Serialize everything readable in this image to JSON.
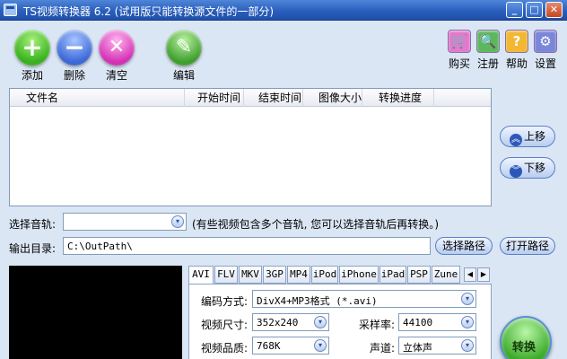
{
  "window": {
    "title": "TS视频转换器 6.2 (试用版只能转换源文件的一部分)",
    "min_glyph": "_",
    "max_glyph": "□",
    "close_glyph": "✕"
  },
  "toolbar": {
    "add": {
      "label": "添加",
      "glyph": "+",
      "icon": "add-icon"
    },
    "delete": {
      "label": "删除",
      "glyph": "−",
      "icon": "remove-icon"
    },
    "clear": {
      "label": "清空",
      "glyph": "✕",
      "icon": "clear-icon"
    },
    "edit": {
      "label": "编辑",
      "glyph": "✎",
      "icon": "edit-image-icon"
    }
  },
  "right_toolbar": {
    "buy": {
      "label": "购买",
      "glyph": "🛒",
      "icon": "cart-icon",
      "color": "#e07acb"
    },
    "register": {
      "label": "注册",
      "glyph": "🔍",
      "icon": "search-key-icon",
      "color": "#5cb85c"
    },
    "help": {
      "label": "帮助",
      "glyph": "?",
      "icon": "help-icon",
      "color": "#f2b733"
    },
    "settings": {
      "label": "设置",
      "glyph": "⚙",
      "icon": "settings-icon",
      "color": "#7a86d8"
    }
  },
  "file_list": {
    "columns": [
      "文件名",
      "开始时间",
      "结束时间",
      "图像大小",
      "转换进度"
    ]
  },
  "side_buttons": {
    "move_up": "上移",
    "move_down": "下移",
    "up_glyph": "︽",
    "down_glyph": "︾"
  },
  "audio_track": {
    "label": "选择音轨:",
    "value": "",
    "hint": "(有些视频包含多个音轨, 您可以选择音轨后再转换。)"
  },
  "output": {
    "label": "输出目录:",
    "value": "C:\\OutPath\\",
    "choose_button": "选择路径",
    "open_button": "打开路径"
  },
  "format_tabs": {
    "items": [
      "AVI",
      "FLV",
      "MKV",
      "3GP",
      "MP4",
      "iPod",
      "iPhone",
      "iPad",
      "PSP",
      "Zune"
    ],
    "active": "AVI",
    "left_arrow": "◀",
    "right_arrow": "▶"
  },
  "settings_panel": {
    "codec_label": "编码方式:",
    "codec_value": "DivX4+MP3格式 (*.avi)",
    "size_label": "视频尺寸:",
    "size_value": "352x240",
    "sample_rate_label": "采样率:",
    "sample_rate_value": "44100",
    "quality_label": "视频品质:",
    "quality_value": "768K",
    "channel_label": "声道:",
    "channel_value": "立体声"
  },
  "convert_button": "转换",
  "combo_arrow": "▾"
}
